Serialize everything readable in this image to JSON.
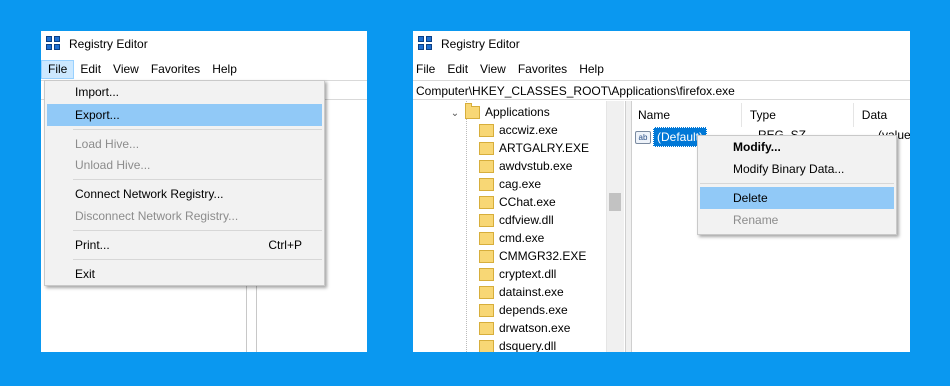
{
  "left_window": {
    "title": "Registry Editor",
    "menu": [
      "File",
      "Edit",
      "View",
      "Favorites",
      "Help"
    ],
    "file_menu": {
      "import": "Import...",
      "export": "Export...",
      "load_hive": "Load Hive...",
      "unload_hive": "Unload Hive...",
      "connect": "Connect Network Registry...",
      "disconnect": "Disconnect Network Registry...",
      "print": "Print...",
      "print_shortcut": "Ctrl+P",
      "exit": "Exit"
    }
  },
  "right_window": {
    "title": "Registry Editor",
    "menu": [
      "File",
      "Edit",
      "View",
      "Favorites",
      "Help"
    ],
    "address": "Computer\\HKEY_CLASSES_ROOT\\Applications\\firefox.exe",
    "tree": {
      "parent": "Applications",
      "children": [
        "accwiz.exe",
        "ARTGALRY.EXE",
        "awdvstub.exe",
        "cag.exe",
        "CChat.exe",
        "cdfview.dll",
        "cmd.exe",
        "CMMGR32.EXE",
        "cryptext.dll",
        "datainst.exe",
        "depends.exe",
        "drwatson.exe",
        "dsquery.dll"
      ]
    },
    "columns": {
      "name": "Name",
      "type": "Type",
      "data": "Data"
    },
    "row": {
      "icon": "ab",
      "name": "(Default)",
      "type": "REG_SZ",
      "data": "(value"
    },
    "context_menu": {
      "modify": "Modify...",
      "modify_binary": "Modify Binary Data...",
      "delete": "Delete",
      "rename": "Rename"
    }
  },
  "colors": {
    "background": "#0a98f0",
    "highlight": "#91c9f7",
    "selection": "#0078d7"
  }
}
